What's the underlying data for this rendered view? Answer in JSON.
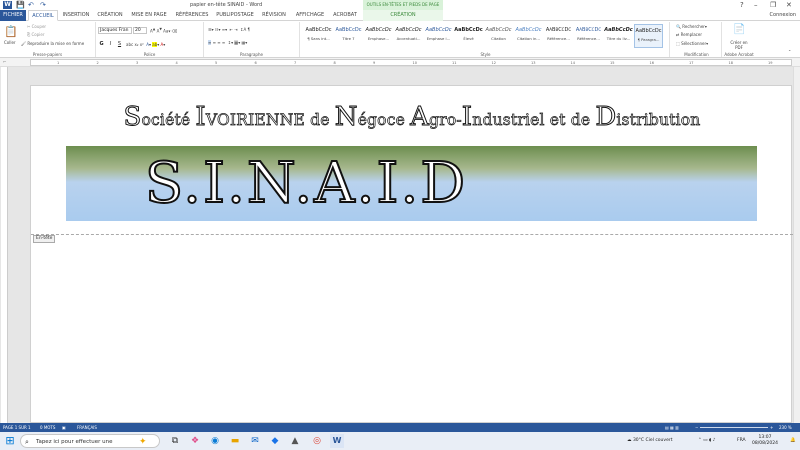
{
  "window": {
    "title": "papier en-tête SINAID - Word",
    "context_group": "OUTILS EN-TÊTES ET PIEDS DE PAGE",
    "app_icon": "W",
    "qa_save": "save-icon",
    "qa_undo": "undo-icon",
    "qa_redo": "redo-icon",
    "help": "?",
    "minimize": "–",
    "restore": "❐",
    "close": "✕"
  },
  "tabs": [
    "FICHIER",
    "ACCUEIL",
    "INSERTION",
    "CRÉATION",
    "MISE EN PAGE",
    "RÉFÉRENCES",
    "PUBLIPOSTAGE",
    "RÉVISION",
    "AFFICHAGE",
    "ACROBAT",
    "CRÉATION"
  ],
  "account": "Connexion",
  "ribbon": {
    "clipboard": {
      "paste": "Coller",
      "cut": "Couper",
      "copy": "Copier",
      "format_painter": "Reproduire la mise en forme",
      "label": "Presse-papiers"
    },
    "font": {
      "name": "Jacques Fran",
      "size": "20",
      "label": "Police",
      "bold": "G",
      "italic": "I",
      "underline": "S"
    },
    "paragraph": {
      "label": "Paragraphe"
    },
    "styles": {
      "label": "Style",
      "items": [
        {
          "preview": "AaBbCcDc",
          "name": "¶ Sans int..."
        },
        {
          "preview": "AaBbCcDc",
          "name": "Titre 7"
        },
        {
          "preview": "AaBbCcDc",
          "name": "Emphase..."
        },
        {
          "preview": "AaBbCcDc",
          "name": "Accentuati..."
        },
        {
          "preview": "AaBbCcDc",
          "name": "Emphase i..."
        },
        {
          "preview": "AaBbCcDc",
          "name": "Élevé"
        },
        {
          "preview": "AaBbCcDc",
          "name": "Citation"
        },
        {
          "preview": "AaBbCcDc",
          "name": "Citation in..."
        },
        {
          "preview": "AaBbCcDc",
          "name": "Référence..."
        },
        {
          "preview": "AaBbCcDc",
          "name": "Référence..."
        },
        {
          "preview": "AaBbCcDc",
          "name": "Titre du liv..."
        },
        {
          "preview": "AaBbCcDc",
          "name": "¶ Paragra..."
        }
      ]
    },
    "editing": {
      "find": "Rechercher",
      "replace": "Remplacer",
      "select": "Sélectionner",
      "label": "Modification"
    },
    "acrobat": {
      "create_pdf": "Créer en PDF",
      "label": "Adobe Acrobat"
    }
  },
  "ruler": {
    "ticks": [
      "1",
      "2",
      "3",
      "4",
      "5",
      "6",
      "7",
      "8",
      "9",
      "10",
      "11",
      "12",
      "13",
      "14",
      "15",
      "16",
      "17",
      "18",
      "19"
    ]
  },
  "document": {
    "company_parts": [
      {
        "cap": "S",
        "rest": "ociété "
      },
      {
        "cap": "I",
        "rest": "VOIRIENNE de "
      },
      {
        "cap": "N",
        "rest": "égoce "
      },
      {
        "cap": "A",
        "rest": "gro-"
      },
      {
        "cap": "I",
        "rest": "ndustriel et de "
      },
      {
        "cap": "D",
        "rest": "istribution"
      }
    ],
    "acronym": "S.I.N.A.I.D",
    "header_tag": "En-tête"
  },
  "statusbar": {
    "page": "PAGE 1 SUR 1",
    "words": "0 MOTS",
    "language": "FRANÇAIS",
    "zoom": "230 %"
  },
  "taskbar": {
    "search_placeholder": "Tapez ici pour effectuer une",
    "weather": "30°C Ciel couvert",
    "lang": "FRA",
    "time": "13:07",
    "date": "08/08/2024"
  }
}
